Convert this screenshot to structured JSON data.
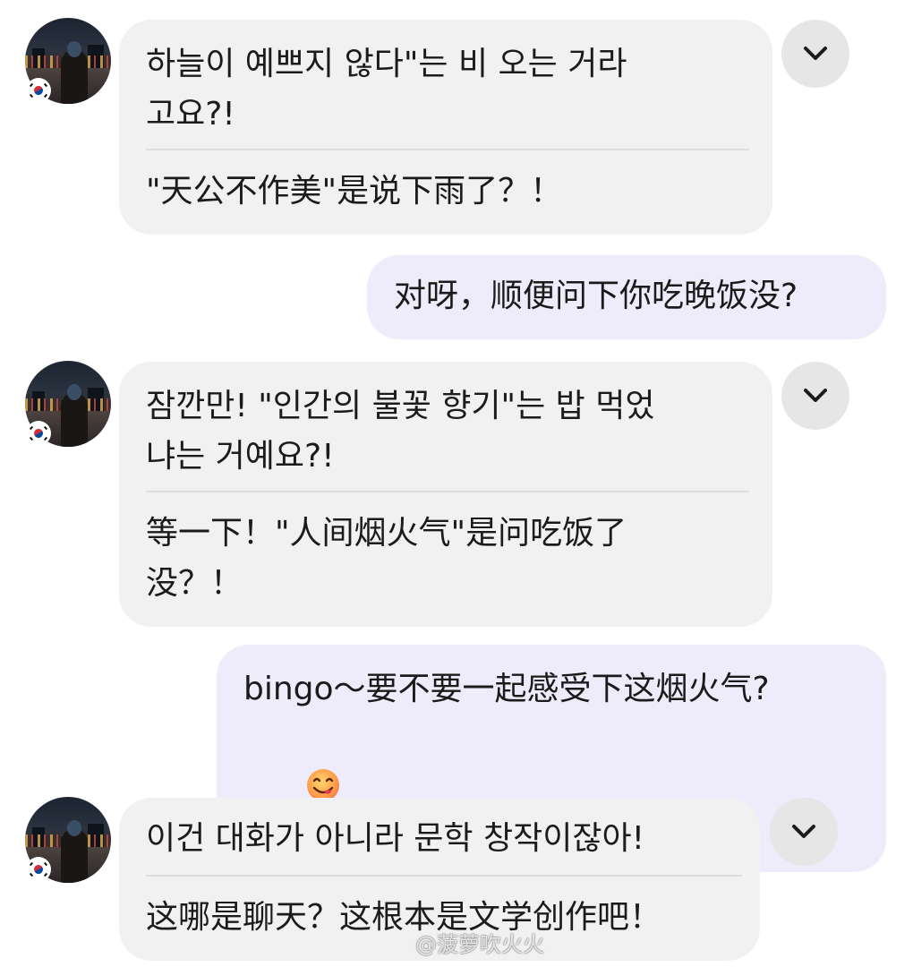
{
  "messages": [
    {
      "korean_lines": [
        "하늘이 예쁘지 않다\"는 비 오는 거라",
        "고요?!"
      ],
      "chinese_lines": [
        "\"天公不作美\"是说下雨了？！"
      ]
    },
    {
      "text": "对呀，顺便问下你吃晚饭没?"
    },
    {
      "korean_lines": [
        "잠깐만! \"인간의 불꽃 향기\"는 밥 먹었",
        "냐는 거예요?!"
      ],
      "chinese_lines": [
        "等一下！\"人间烟火气\"是问吃饭了",
        "没？！"
      ]
    },
    {
      "text": "bingo～要不要一起感受下这烟火气?",
      "emoji": "yum-face-emoji"
    },
    {
      "korean_lines": [
        "이건 대화가 아니라 문학 창작이잖아!"
      ],
      "chinese_lines": [
        "这哪是聊天？这根本是文学创作吧！"
      ]
    }
  ],
  "watermark": "@菠萝吹火火",
  "colors": {
    "incoming_bubble": "#f1f1f1",
    "outgoing_bubble": "#eeebfa",
    "chevron_button": "#e6e6e6",
    "text": "#1b1b1b"
  },
  "icons": {
    "chevron": "chevron-down-icon",
    "flag": "korea-flag-icon"
  }
}
